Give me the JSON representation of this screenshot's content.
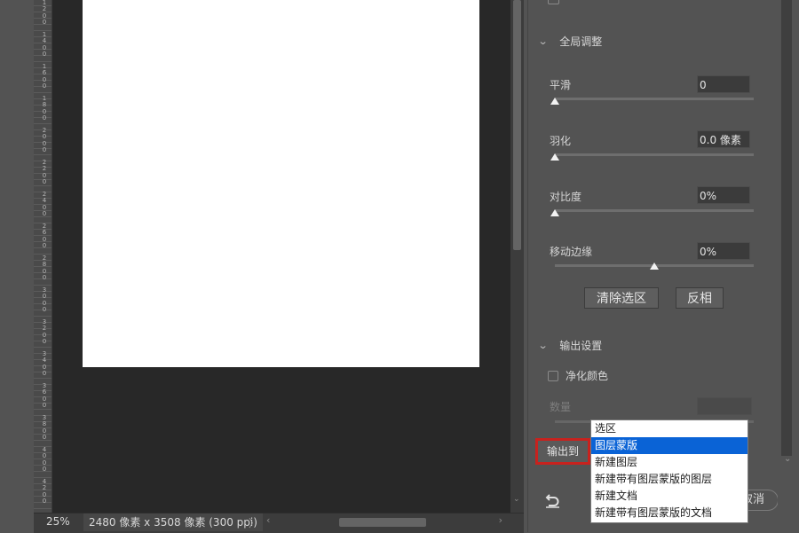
{
  "ruler": {
    "labels": [
      "1",
      "2",
      "0",
      "0",
      "1",
      "4",
      "0",
      "0",
      "1",
      "6",
      "0",
      "0",
      "1",
      "8",
      "0",
      "0",
      "2",
      "0",
      "0",
      "0",
      "2",
      "2",
      "0",
      "0",
      "2",
      "4",
      "0",
      "0",
      "2",
      "6",
      "0",
      "0",
      "2",
      "8",
      "0",
      "0",
      "3",
      "0",
      "0",
      "0",
      "3",
      "2",
      "0",
      "0",
      "3",
      "4",
      "0",
      "0",
      "3",
      "6",
      "0",
      "0",
      "3",
      "8",
      "0",
      "0",
      "4",
      "0",
      "0",
      "0",
      "4",
      "2",
      "0",
      "0"
    ]
  },
  "status": {
    "zoom": "25%",
    "doc_info": "2480 像素 x 3508 像素 (300 ppi)",
    "doc_info_arrow": "〉"
  },
  "panel": {
    "global_adjust": {
      "title": "全局调整",
      "smooth": {
        "label": "平滑",
        "value": "0",
        "level": 0
      },
      "feather": {
        "label": "羽化",
        "value": "0.0 像素",
        "level": 0
      },
      "contrast": {
        "label": "对比度",
        "value": "0%",
        "level": 0
      },
      "shift_edge": {
        "label": "移动边缘",
        "value": "0%",
        "level": 0.5
      },
      "clear_selection": "清除选区",
      "invert": "反相"
    },
    "output": {
      "title": "输出设置",
      "decontaminate_label": "净化颜色",
      "amount_label": "数量",
      "output_to_label": "输出到"
    },
    "cancel_label": "取消"
  },
  "dropdown": {
    "options": [
      "选区",
      "图层蒙版",
      "新建图层",
      "新建带有图层蒙版的图层",
      "新建文档",
      "新建带有图层蒙版的文档"
    ],
    "selected": "图层蒙版"
  },
  "colors": {
    "highlight_border": "#c8221e",
    "selected_item": "#0a63d6"
  }
}
